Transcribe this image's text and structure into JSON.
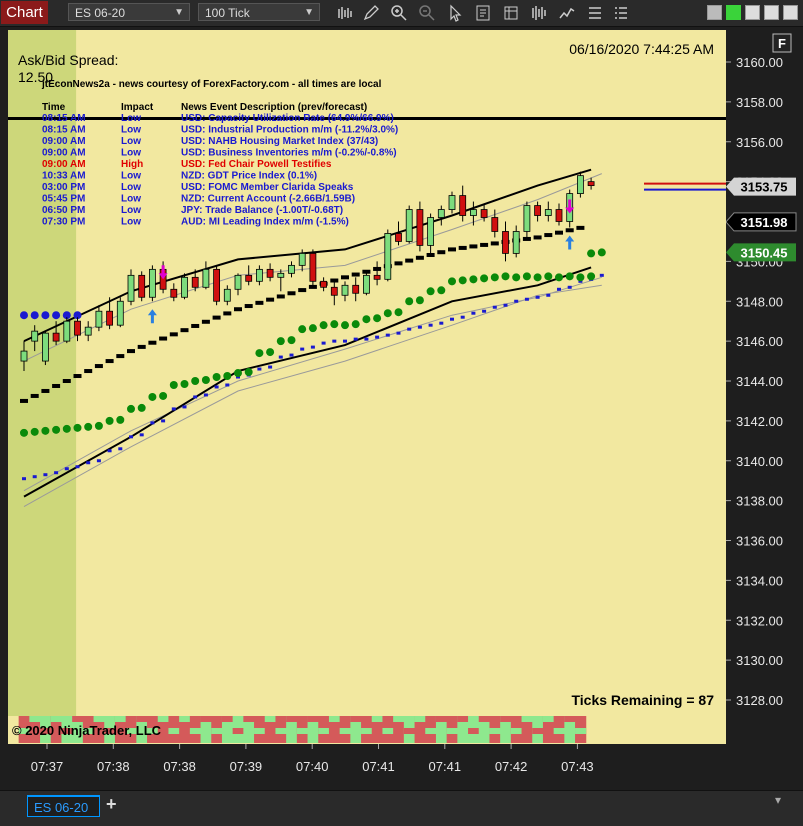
{
  "toolbar": {
    "chart_label": "Chart",
    "instrument": "ES 06-20",
    "interval": "100 Tick",
    "icons": [
      "bar-type-icon",
      "draw-pencil-icon",
      "zoom-in-icon",
      "zoom-out-icon",
      "cursor-icon",
      "properties-icon",
      "data-box-icon",
      "strategy-icon",
      "indicators-icon",
      "lines-icon"
    ]
  },
  "window": {
    "buttons": [
      "minimize",
      "maximize",
      "restore",
      "close"
    ]
  },
  "chart_data": {
    "type": "candlestick",
    "title": "",
    "timestamp": "06/16/2020 7:44:25 AM",
    "spread_label": "Ask/Bid Spread:",
    "spread_value": "12.50",
    "ticks_remaining": "Ticks Remaining = 87",
    "copyright": "© 2020 NinjaTrader, LLC",
    "f_badge": "F",
    "ylim": [
      3127,
      3163
    ],
    "y_ticks": [
      3128,
      3130,
      3132,
      3134,
      3136,
      3138,
      3140,
      3142,
      3144,
      3146,
      3148,
      3150,
      3152,
      3154,
      3156,
      3158,
      3160
    ],
    "y_tick_labels": [
      "3128.00",
      "3130.00",
      "3132.00",
      "3134.00",
      "3136.00",
      "3138.00",
      "3140.00",
      "3142.00",
      "3144.00",
      "3146.00",
      "3148.00",
      "3150.00",
      "3152.00",
      "3154.00",
      "3156.00",
      "3158.00",
      "3160.00"
    ],
    "x_ticks": [
      "07:37",
      "07:38",
      "07:38",
      "07:39",
      "07:40",
      "07:41",
      "07:41",
      "07:42",
      "07:43"
    ],
    "price_flags": [
      {
        "label": "3153.75",
        "value": 3153.75,
        "bg": "#d4d4d4",
        "fg": "#000000"
      },
      {
        "label": "3151.98",
        "value": 3151.98,
        "bg": "#000000",
        "fg": "#ffffff"
      },
      {
        "label": "3150.45",
        "value": 3150.45,
        "bg": "#2e8b2e",
        "fg": "#ffffff"
      }
    ],
    "candles": [
      [
        3145.0,
        3146.0,
        3144.5,
        3145.5
      ],
      [
        3146.0,
        3146.8,
        3145.5,
        3146.5
      ],
      [
        3145.0,
        3146.5,
        3144.8,
        3146.4
      ],
      [
        3146.4,
        3147.0,
        3145.8,
        3146.0
      ],
      [
        3146.0,
        3147.2,
        3145.9,
        3147.0
      ],
      [
        3147.0,
        3147.2,
        3146.0,
        3146.3
      ],
      [
        3146.3,
        3147.0,
        3146.0,
        3146.7
      ],
      [
        3146.7,
        3147.8,
        3146.5,
        3147.5
      ],
      [
        3147.5,
        3148.2,
        3146.6,
        3146.8
      ],
      [
        3146.8,
        3148.2,
        3146.7,
        3148.0
      ],
      [
        3148.0,
        3149.6,
        3147.8,
        3149.3
      ],
      [
        3149.3,
        3149.5,
        3148.0,
        3148.2
      ],
      [
        3148.2,
        3149.8,
        3148.0,
        3149.6
      ],
      [
        3149.6,
        3150.0,
        3148.4,
        3148.6
      ],
      [
        3148.6,
        3148.9,
        3148.0,
        3148.2
      ],
      [
        3148.2,
        3149.4,
        3148.1,
        3149.2
      ],
      [
        3149.2,
        3149.6,
        3148.5,
        3148.7
      ],
      [
        3148.7,
        3150.0,
        3148.6,
        3149.6
      ],
      [
        3149.6,
        3149.8,
        3147.8,
        3148.0
      ],
      [
        3148.0,
        3148.8,
        3147.8,
        3148.6
      ],
      [
        3148.6,
        3149.4,
        3148.3,
        3149.3
      ],
      [
        3149.3,
        3149.8,
        3148.8,
        3149.0
      ],
      [
        3149.0,
        3149.8,
        3148.8,
        3149.6
      ],
      [
        3149.6,
        3149.9,
        3149.0,
        3149.2
      ],
      [
        3149.2,
        3149.6,
        3148.5,
        3149.4
      ],
      [
        3149.4,
        3150.0,
        3149.2,
        3149.8
      ],
      [
        3149.8,
        3150.6,
        3149.5,
        3150.4
      ],
      [
        3150.4,
        3150.6,
        3148.8,
        3149.0
      ],
      [
        3149.0,
        3149.2,
        3148.5,
        3148.7
      ],
      [
        3148.7,
        3149.0,
        3147.8,
        3148.3
      ],
      [
        3148.3,
        3149.0,
        3148.0,
        3148.8
      ],
      [
        3148.8,
        3149.2,
        3148.0,
        3148.4
      ],
      [
        3148.4,
        3149.5,
        3148.3,
        3149.3
      ],
      [
        3149.3,
        3150.0,
        3148.8,
        3149.1
      ],
      [
        3149.1,
        3151.6,
        3149.0,
        3151.4
      ],
      [
        3151.4,
        3152.0,
        3150.8,
        3151.0
      ],
      [
        3151.0,
        3152.8,
        3150.9,
        3152.6
      ],
      [
        3152.6,
        3153.0,
        3150.5,
        3150.8
      ],
      [
        3150.8,
        3152.4,
        3150.4,
        3152.2
      ],
      [
        3152.2,
        3152.8,
        3151.8,
        3152.6
      ],
      [
        3152.6,
        3153.5,
        3152.4,
        3153.3
      ],
      [
        3153.3,
        3153.8,
        3152.0,
        3152.3
      ],
      [
        3152.3,
        3153.0,
        3151.8,
        3152.6
      ],
      [
        3152.6,
        3152.9,
        3152.0,
        3152.2
      ],
      [
        3152.2,
        3152.6,
        3151.2,
        3151.5
      ],
      [
        3151.5,
        3152.0,
        3150.0,
        3150.4
      ],
      [
        3150.4,
        3151.8,
        3150.2,
        3151.5
      ],
      [
        3151.5,
        3153.0,
        3151.2,
        3152.8
      ],
      [
        3152.8,
        3153.0,
        3152.0,
        3152.3
      ],
      [
        3152.3,
        3153.0,
        3152.0,
        3152.6
      ],
      [
        3152.6,
        3152.9,
        3151.8,
        3152.0
      ],
      [
        3152.0,
        3153.6,
        3151.7,
        3153.4
      ],
      [
        3153.4,
        3154.5,
        3153.2,
        3154.3
      ],
      [
        3154.0,
        3154.2,
        3153.6,
        3153.8
      ]
    ],
    "sar_blue": [
      [
        0,
        3139.1
      ],
      [
        2,
        3139.3
      ],
      [
        4,
        3139.6
      ],
      [
        6,
        3139.9
      ],
      [
        8,
        3140.5
      ],
      [
        10,
        3141.2
      ],
      [
        12,
        3141.9
      ],
      [
        14,
        3142.6
      ],
      [
        16,
        3143.2
      ],
      [
        18,
        3143.7
      ],
      [
        20,
        3144.2
      ],
      [
        22,
        3144.6
      ],
      [
        24,
        3145.2
      ],
      [
        26,
        3145.6
      ],
      [
        28,
        3145.9
      ],
      [
        30,
        3146.0
      ],
      [
        32,
        3146.1
      ],
      [
        34,
        3146.3
      ],
      [
        36,
        3146.6
      ],
      [
        38,
        3146.8
      ],
      [
        40,
        3147.1
      ],
      [
        42,
        3147.4
      ],
      [
        44,
        3147.7
      ],
      [
        46,
        3148.0
      ],
      [
        48,
        3148.2
      ],
      [
        50,
        3148.6
      ],
      [
        52,
        3149.0
      ],
      [
        53,
        3149.2
      ]
    ],
    "dots_green": [
      [
        0,
        3141.4
      ],
      [
        2,
        3141.5
      ],
      [
        4,
        3141.6
      ],
      [
        6,
        3141.7
      ],
      [
        8,
        3142.0
      ],
      [
        10,
        3142.6
      ],
      [
        12,
        3143.2
      ],
      [
        14,
        3143.8
      ],
      [
        16,
        3144.0
      ],
      [
        18,
        3144.2
      ],
      [
        20,
        3144.4
      ],
      [
        22,
        3145.4
      ],
      [
        24,
        3146.0
      ],
      [
        26,
        3146.6
      ],
      [
        28,
        3146.8
      ],
      [
        30,
        3146.8
      ],
      [
        32,
        3147.1
      ],
      [
        34,
        3147.4
      ],
      [
        36,
        3148.0
      ],
      [
        38,
        3148.5
      ],
      [
        40,
        3149.0
      ],
      [
        42,
        3149.1
      ],
      [
        44,
        3149.2
      ],
      [
        46,
        3149.2
      ],
      [
        48,
        3149.2
      ],
      [
        50,
        3149.2
      ],
      [
        52,
        3149.2
      ],
      [
        53,
        3150.4
      ]
    ],
    "blue_dots_left": [
      3147.3
    ],
    "bands": {
      "upper_black": [
        [
          0,
          3146.0
        ],
        [
          10,
          3148.5
        ],
        [
          20,
          3150.1
        ],
        [
          30,
          3150.6
        ],
        [
          40,
          3152.3
        ],
        [
          48,
          3153.8
        ],
        [
          53,
          3154.6
        ]
      ],
      "upper_gray": [
        [
          0,
          3145.0
        ],
        [
          10,
          3147.6
        ],
        [
          20,
          3149.3
        ],
        [
          30,
          3149.8
        ],
        [
          40,
          3151.6
        ],
        [
          48,
          3153.1
        ],
        [
          54,
          3154.4
        ]
      ],
      "lower_gray": [
        [
          0,
          3138.5
        ],
        [
          10,
          3141.5
        ],
        [
          20,
          3144.0
        ],
        [
          30,
          3145.6
        ],
        [
          40,
          3147.3
        ],
        [
          48,
          3148.2
        ],
        [
          54,
          3149.2
        ]
      ],
      "lower_black": [
        [
          0,
          3138.2
        ],
        [
          10,
          3141.2
        ],
        [
          20,
          3144.5
        ],
        [
          30,
          3145.8
        ],
        [
          40,
          3148.0
        ],
        [
          48,
          3148.8
        ],
        [
          53,
          3149.7
        ]
      ],
      "lower_gray2": [
        [
          0,
          3137.7
        ],
        [
          10,
          3140.7
        ],
        [
          20,
          3143.5
        ],
        [
          30,
          3145.0
        ],
        [
          40,
          3146.8
        ],
        [
          48,
          3148.3
        ],
        [
          54,
          3148.8
        ]
      ],
      "mid_steps": [
        [
          0,
          3143.0
        ],
        [
          10,
          3145.5
        ],
        [
          20,
          3147.6
        ],
        [
          30,
          3149.2
        ],
        [
          40,
          3150.6
        ],
        [
          48,
          3151.2
        ],
        [
          53,
          3151.8
        ]
      ]
    },
    "session_shading_until_bar": 3,
    "order_flow_strip": [
      "r",
      "r",
      "g",
      "r",
      "g",
      "g",
      "r",
      "r",
      "g",
      "r",
      "r",
      "g",
      "r",
      "r",
      "r",
      "r",
      "r",
      "g",
      "r",
      "g",
      "g",
      "g",
      "r",
      "r",
      "r",
      "g",
      "r",
      "g",
      "r",
      "r",
      "r",
      "g",
      "r",
      "r",
      "r",
      "r",
      "g",
      "r",
      "r",
      "g",
      "r",
      "g",
      "g",
      "g",
      "r",
      "g",
      "r",
      "r",
      "g",
      "r",
      "r",
      "g",
      "r"
    ],
    "signals": [
      {
        "bar": 13,
        "dir": "down",
        "color": "#e000d0"
      },
      {
        "bar": 12,
        "dir": "up",
        "color": "#2a80e0"
      },
      {
        "bar": 51,
        "dir": "down",
        "color": "#e000d0"
      },
      {
        "bar": 51,
        "dir": "up",
        "color": "#2a80e0"
      }
    ]
  },
  "news": {
    "title": "jtEconNews2a - news courtesy of ForexFactory.com - all times are local",
    "headers": {
      "time": "Time",
      "impact": "Impact",
      "desc": "News Event Description (prev/forecast)"
    },
    "rows": [
      {
        "time": "08:15 AM",
        "impact": "Low",
        "desc": "USD: Capacity Utilization Rate (64.9%/66.9%)",
        "color": "#1a1ad0"
      },
      {
        "time": "08:15 AM",
        "impact": "Low",
        "desc": "USD: Industrial Production m/m (-11.2%/3.0%)",
        "color": "#1a1ad0"
      },
      {
        "time": "09:00 AM",
        "impact": "Low",
        "desc": "USD: NAHB Housing Market Index (37/43)",
        "color": "#1a1ad0"
      },
      {
        "time": "09:00 AM",
        "impact": "Low",
        "desc": "USD: Business Inventories m/m (-0.2%/-0.8%)",
        "color": "#1a1ad0"
      },
      {
        "time": "09:00 AM",
        "impact": "High",
        "desc": "USD: Fed Chair Powell Testifies",
        "color": "#e00000"
      },
      {
        "time": "10:33 AM",
        "impact": "Low",
        "desc": "NZD: GDT Price Index (0.1%)",
        "color": "#1a1ad0"
      },
      {
        "time": "03:00 PM",
        "impact": "Low",
        "desc": "USD: FOMC Member Clarida Speaks",
        "color": "#1a1ad0"
      },
      {
        "time": "05:45 PM",
        "impact": "Low",
        "desc": "NZD: Current Account (-2.66B/1.59B)",
        "color": "#1a1ad0"
      },
      {
        "time": "06:50 PM",
        "impact": "Low",
        "desc": "JPY: Trade Balance (-1.00T/-0.68T)",
        "color": "#1a1ad0"
      },
      {
        "time": "07:30 PM",
        "impact": "Low",
        "desc": "AUD: MI Leading Index m/m (-1.5%)",
        "color": "#1a1ad0"
      }
    ]
  },
  "bottom": {
    "tab_label": "ES 06-20",
    "add_label": "+"
  }
}
